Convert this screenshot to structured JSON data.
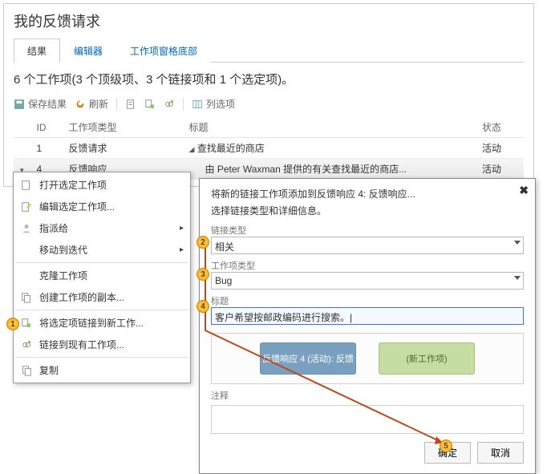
{
  "panel": {
    "title": "我的反馈请求",
    "tabs": {
      "results": "结果",
      "editor": "编辑器",
      "footer": "工作项窗格底部"
    },
    "summary": "6 个工作项(3 个顶级项、3 个链接项和 1 个选定项)。",
    "toolbar": {
      "save": "保存结果",
      "refresh": "刷新",
      "columns": "列选项"
    },
    "grid": {
      "headers": {
        "id": "ID",
        "type": "工作项类型",
        "title": "标题",
        "state": "状态"
      },
      "rows": [
        {
          "id": "1",
          "type": "反馈请求",
          "title": "查找最近的商店",
          "state": "活动",
          "expander": "◢"
        },
        {
          "id": "4",
          "type": "反馈响应",
          "title": "由 Peter Waxman 提供的有关查找最近的商店...",
          "state": "活动"
        }
      ]
    }
  },
  "menu": {
    "open": "打开选定工作项",
    "edit": "编辑选定工作项...",
    "assign": "指派给",
    "move": "移动到迭代",
    "clone": "克隆工作项",
    "copy": "创建工作项的副本...",
    "linkNew": "将选定项链接到新工作...",
    "linkExisting": "链接到现有工作项...",
    "duplicate": "复制"
  },
  "dialog": {
    "title": "将新的链接工作项添加到反馈响应 4: 反馈响应...",
    "subtitle": "选择链接类型和详细信息。",
    "labels": {
      "linkType": "链接类型",
      "workItemType": "工作项类型",
      "itemTitle": "标题",
      "notes": "注释"
    },
    "values": {
      "linkType": "相关",
      "workItemType": "Bug",
      "itemTitle": "客户希望按邮政编码进行搜索。|"
    },
    "chips": {
      "left": "反馈响应 4 (活动): 反馈",
      "right": "(新工作项)"
    },
    "buttons": {
      "ok": "确定",
      "cancel": "取消"
    }
  },
  "callouts": {
    "c1": "1",
    "c2": "2",
    "c3": "3",
    "c4": "4",
    "c5": "5"
  }
}
